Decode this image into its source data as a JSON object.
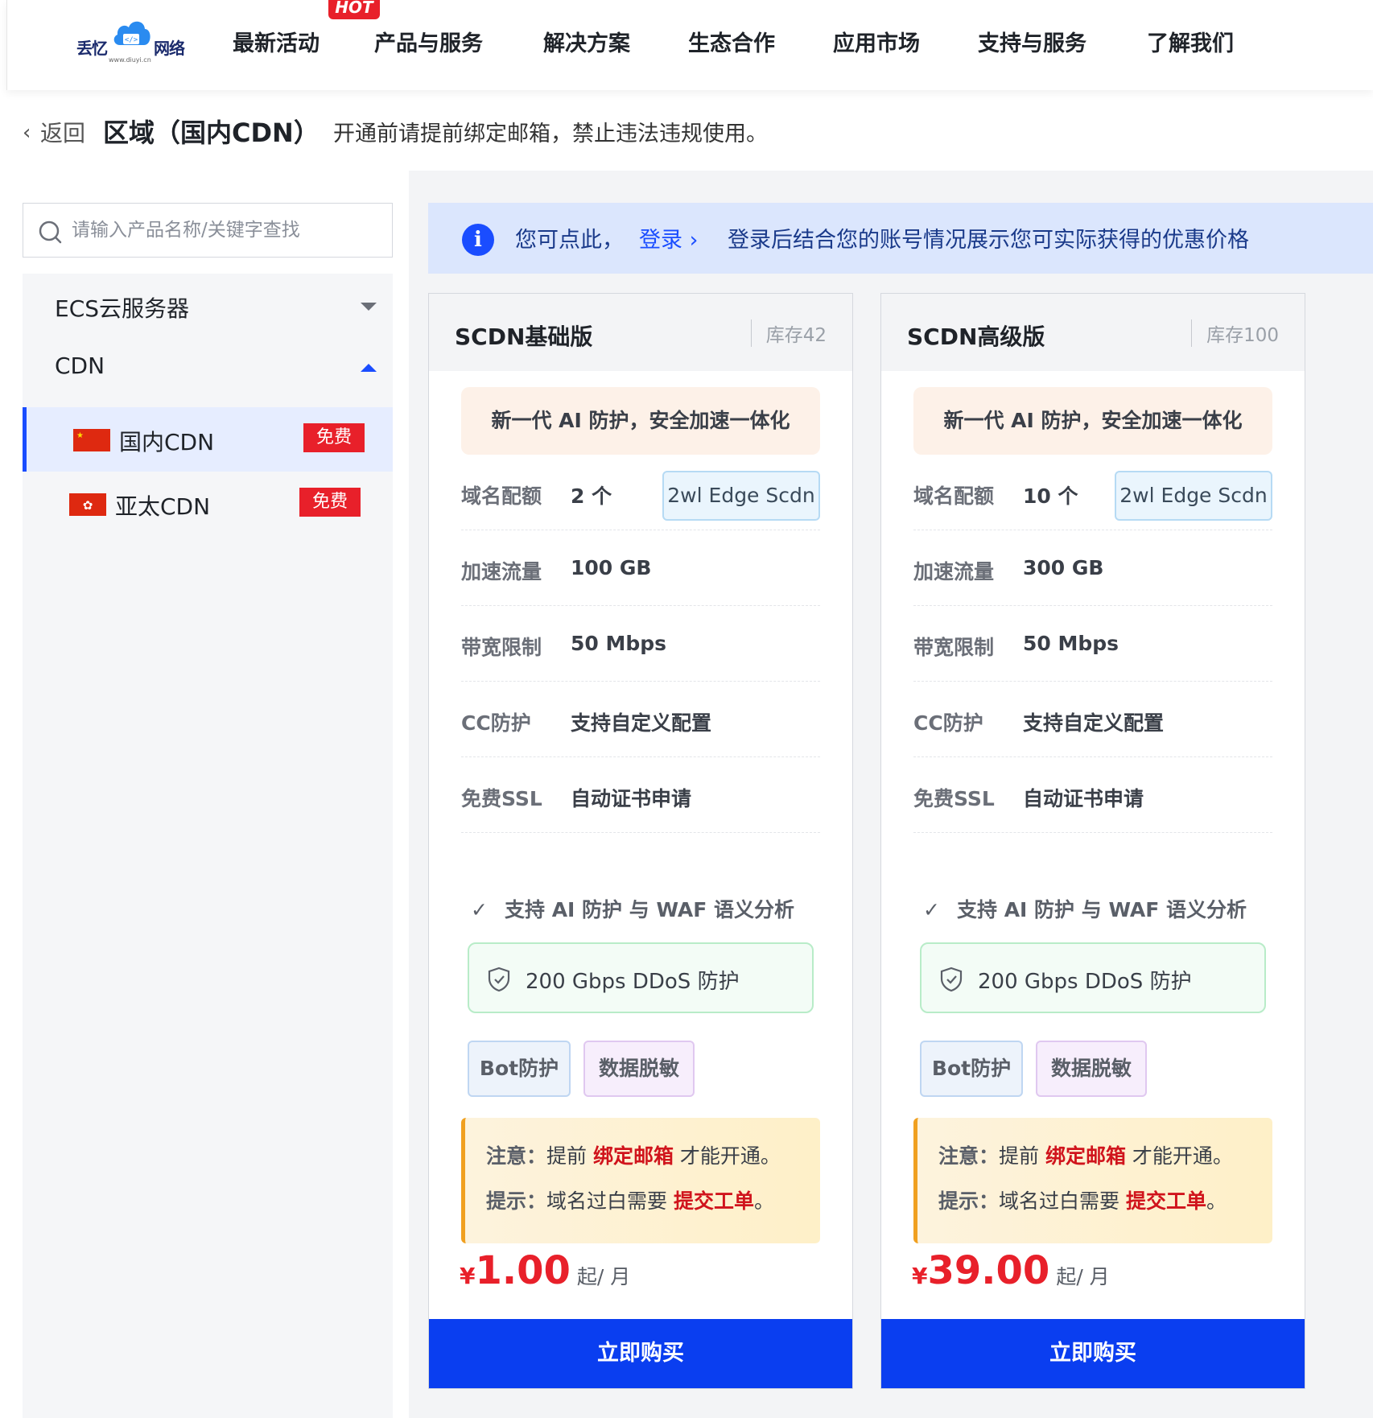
{
  "brand": {
    "name_left": "丢忆",
    "name_right": "网络",
    "domain": "www.diuyi.cn"
  },
  "nav": {
    "hot_badge": "HOT",
    "items": [
      "最新活动",
      "产品与服务",
      "解决方案",
      "生态合作",
      "应用市场",
      "支持与服务",
      "了解我们"
    ]
  },
  "breadcrumb": {
    "back": "返回",
    "title": "区域（国内CDN）",
    "note": "开通前请提前绑定邮箱，禁止违法违规使用。"
  },
  "sidebar": {
    "search_placeholder": "请输入产品名称/关键字查找",
    "groups": [
      "ECS云服务器",
      "CDN"
    ],
    "items": [
      {
        "label": "国内CDN",
        "badge": "免费",
        "flag": "cn-flag-icon",
        "active": true
      },
      {
        "label": "亚太CDN",
        "badge": "免费",
        "flag": "hk-flag-icon",
        "active": false
      }
    ]
  },
  "notice": {
    "text1": "您可点此，",
    "login": "登录 ›",
    "text2": "登录后结合您的账号情况展示您可实际获得的优惠价格"
  },
  "cards": [
    {
      "title": "SCDN基础版",
      "stock": "库存42",
      "slogan": "新一代 AI 防护，安全加速一体化",
      "specs": [
        {
          "k": "域名配额",
          "v": "2 个"
        },
        {
          "k": "加速流量",
          "v": "100 GB"
        },
        {
          "k": "带宽限制",
          "v": "50 Mbps"
        },
        {
          "k": "CC防护",
          "v": "支持自定义配置"
        },
        {
          "k": "免费SSL",
          "v": "自动证书申请"
        }
      ],
      "edge_tag": "2wl Edge Scdn",
      "feature": "支持 AI 防护 与 WAF 语义分析",
      "ddos": "200 Gbps DDoS 防护",
      "chips": [
        "Bot防护",
        "数据脱敏"
      ],
      "tip1": {
        "label": "注意：",
        "pre": "提前 ",
        "hl": "绑定邮箱",
        "post": " 才能开通。"
      },
      "tip2": {
        "label": "提示：",
        "pre": "域名过白需要 ",
        "hl": "提交工单",
        "post": "。"
      },
      "price": {
        "currency": "¥",
        "amount": "1.00",
        "unit": "起/ 月"
      },
      "buy": "立即购买"
    },
    {
      "title": "SCDN高级版",
      "stock": "库存100",
      "slogan": "新一代 AI 防护，安全加速一体化",
      "specs": [
        {
          "k": "域名配额",
          "v": "10 个"
        },
        {
          "k": "加速流量",
          "v": "300 GB"
        },
        {
          "k": "带宽限制",
          "v": "50 Mbps"
        },
        {
          "k": "CC防护",
          "v": "支持自定义配置"
        },
        {
          "k": "免费SSL",
          "v": "自动证书申请"
        }
      ],
      "edge_tag": "2wl Edge Scdn",
      "feature": "支持 AI 防护 与 WAF 语义分析",
      "ddos": "200 Gbps DDoS 防护",
      "chips": [
        "Bot防护",
        "数据脱敏"
      ],
      "tip1": {
        "label": "注意：",
        "pre": "提前 ",
        "hl": "绑定邮箱",
        "post": " 才能开通。"
      },
      "tip2": {
        "label": "提示：",
        "pre": "域名过白需要 ",
        "hl": "提交工单",
        "post": "。"
      },
      "price": {
        "currency": "¥",
        "amount": "39.00",
        "unit": "起/ 月"
      },
      "buy": "立即购买"
    }
  ],
  "colors": {
    "accent": "#1a4dff",
    "buy_button": "#0a3ef0",
    "price": "#e8202a",
    "badge": "#e8202a"
  }
}
